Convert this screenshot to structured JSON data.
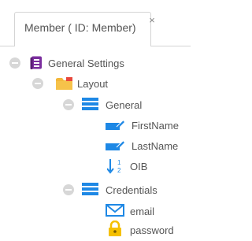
{
  "tab": {
    "title": "Member ( ID: Member)",
    "close_glyph": "×"
  },
  "tree": {
    "root": {
      "label": "General Settings",
      "icon": "settings-list-icon",
      "color": "#7b2e9e"
    },
    "layout": {
      "label": "Layout",
      "icon": "folder-icon",
      "color": "#f3b73a"
    },
    "general": {
      "label": "General",
      "icon": "section-panel-icon",
      "fields": [
        {
          "label": "FirstName",
          "icon": "text-field-icon"
        },
        {
          "label": "LastName",
          "icon": "text-field-icon"
        },
        {
          "label": "OIB",
          "icon": "numeric-sort-icon"
        }
      ]
    },
    "credentials": {
      "label": "Credentials",
      "icon": "section-panel-icon",
      "fields": [
        {
          "label": "email",
          "icon": "email-icon"
        },
        {
          "label": "password",
          "icon": "lock-icon"
        }
      ]
    }
  },
  "colors": {
    "accent_blue": "#1e88e5",
    "toggle_gray": "#d7d7d7",
    "lock_yellow": "#f5c000"
  }
}
